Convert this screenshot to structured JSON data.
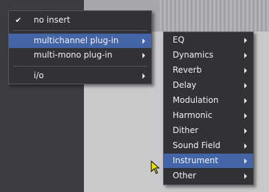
{
  "menu_primary": {
    "items": [
      {
        "label": "no insert",
        "checked": true,
        "submenu": false
      },
      {
        "label": "multichannel plug-in",
        "submenu": true,
        "highlighted": true
      },
      {
        "label": "multi-mono plug-in",
        "submenu": true
      },
      {
        "label": "i/o",
        "submenu": true
      }
    ],
    "check_glyph": "✔"
  },
  "menu_submenu": {
    "items": [
      {
        "label": "EQ"
      },
      {
        "label": "Dynamics"
      },
      {
        "label": "Reverb"
      },
      {
        "label": "Delay"
      },
      {
        "label": "Modulation"
      },
      {
        "label": "Harmonic"
      },
      {
        "label": "Dither"
      },
      {
        "label": "Sound Field"
      },
      {
        "label": "Instrument",
        "highlighted": true
      },
      {
        "label": "Other"
      }
    ]
  },
  "colors": {
    "menu_bg": "#313236",
    "highlight": "#4466a8",
    "text": "#f2f2f2"
  }
}
